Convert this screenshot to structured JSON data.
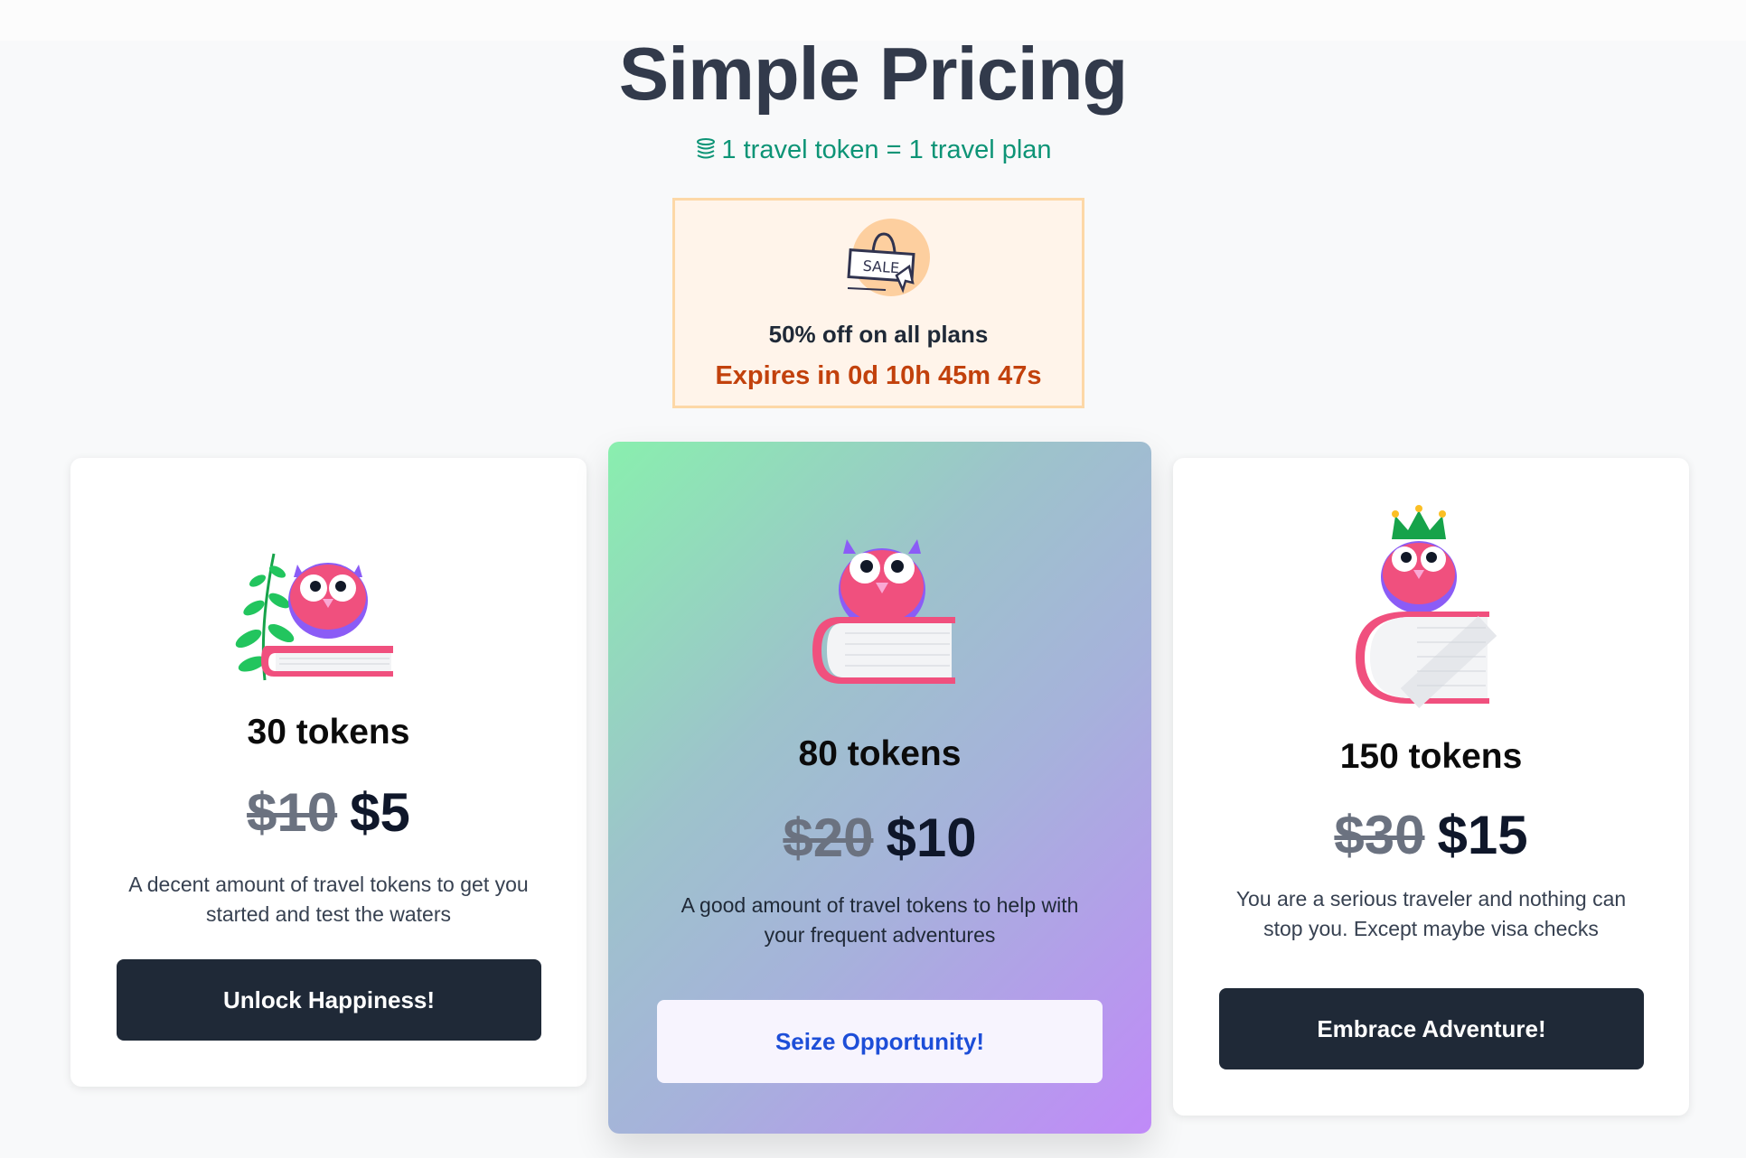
{
  "header": {
    "title": "Simple Pricing",
    "subtitle": "1 travel token = 1 travel plan",
    "subtitle_icon": "coins-icon"
  },
  "sale": {
    "badge_text": "SALE",
    "title": "50% off on all plans",
    "expires": "Expires in 0d 10h 45m 47s"
  },
  "plans": [
    {
      "tokens": "30 tokens",
      "old_price": "$10",
      "price": "$5",
      "description_line1": "A decent amount of travel tokens to get you",
      "description_line2": "started and test the waters",
      "button": "Unlock Happiness!"
    },
    {
      "tokens": "80 tokens",
      "old_price": "$20",
      "price": "$10",
      "description_line1": "A good amount of travel tokens to help with",
      "description_line2": "your frequent adventures",
      "button": "Seize Opportunity!"
    },
    {
      "tokens": "150 tokens",
      "old_price": "$30",
      "price": "$15",
      "description_line1": "You are a serious traveler and nothing can",
      "description_line2": "stop you. Except maybe visa checks",
      "button": "Embrace Adventure!"
    }
  ],
  "colors": {
    "accent_green": "#0d9476",
    "expire_orange": "#c2410c",
    "button_dark": "#1f2937",
    "button_light_text": "#1d4ed8"
  }
}
